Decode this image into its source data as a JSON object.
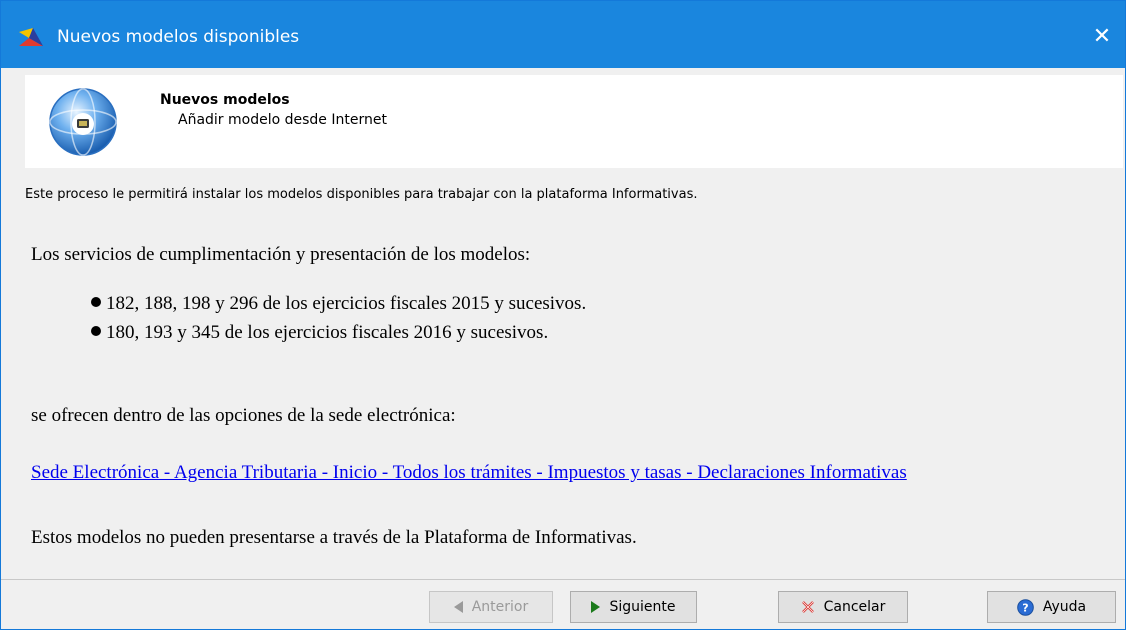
{
  "window": {
    "title": "Nuevos modelos disponibles",
    "close_label": "✕"
  },
  "header": {
    "title": "Nuevos modelos",
    "subtitle": "Añadir modelo desde Internet",
    "icon": "globe-icon"
  },
  "intro_text": "Este proceso le permitirá instalar los modelos disponibles para trabajar con la plataforma Informativas.",
  "content": {
    "paragraph1": "Los servicios de cumplimentación y presentación de los modelos:",
    "bullets": [
      "182, 188, 198 y 296 de los ejercicios fiscales 2015 y sucesivos.",
      "180, 193 y 345 de los ejercicios fiscales 2016 y sucesivos."
    ],
    "paragraph2": "se ofrecen dentro de las opciones de la sede electrónica:",
    "link_text": "Sede Electrónica - Agencia Tributaria - Inicio - Todos los trámites - Impuestos y tasas - Declaraciones Informativas",
    "paragraph3": "Estos modelos no pueden presentarse a través de la Plataforma de Informativas."
  },
  "buttons": {
    "anterior": "Anterior",
    "siguiente": "Siguiente",
    "cancelar": "Cancelar",
    "ayuda": "Ayuda"
  },
  "colors": {
    "titlebar": "#1a86de",
    "link": "#0000ee",
    "cancel_icon": "#d9302c",
    "help_icon": "#2b6cd4",
    "next_icon": "#1b7a1b"
  }
}
